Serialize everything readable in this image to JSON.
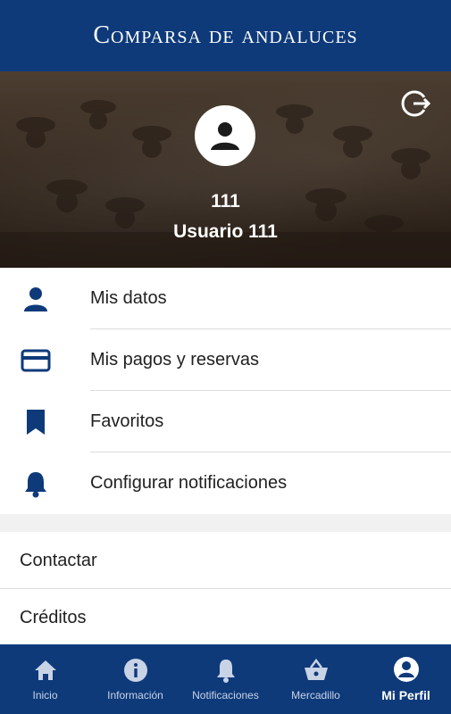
{
  "header": {
    "title": "Comparsa de andaluces"
  },
  "profile": {
    "id": "111",
    "name": "Usuario 111"
  },
  "menu": {
    "items": [
      {
        "label": "Mis datos",
        "icon": "person-icon"
      },
      {
        "label": "Mis pagos y reservas",
        "icon": "credit-card-icon"
      },
      {
        "label": "Favoritos",
        "icon": "bookmark-icon"
      },
      {
        "label": "Configurar notificaciones",
        "icon": "bell-icon"
      }
    ]
  },
  "secondary": {
    "items": [
      {
        "label": "Contactar"
      },
      {
        "label": "Créditos"
      }
    ]
  },
  "nav": {
    "items": [
      {
        "label": "Inicio",
        "icon": "home-icon"
      },
      {
        "label": "Información",
        "icon": "info-icon"
      },
      {
        "label": "Notificaciones",
        "icon": "bell-icon"
      },
      {
        "label": "Mercadillo",
        "icon": "basket-icon"
      },
      {
        "label": "Mi Perfil",
        "icon": "account-circle-icon",
        "active": true
      }
    ]
  },
  "colors": {
    "primary": "#0e3a7a",
    "text": "#212121",
    "divider": "#dcdcdc",
    "nav_inactive": "#c9d3e6"
  }
}
